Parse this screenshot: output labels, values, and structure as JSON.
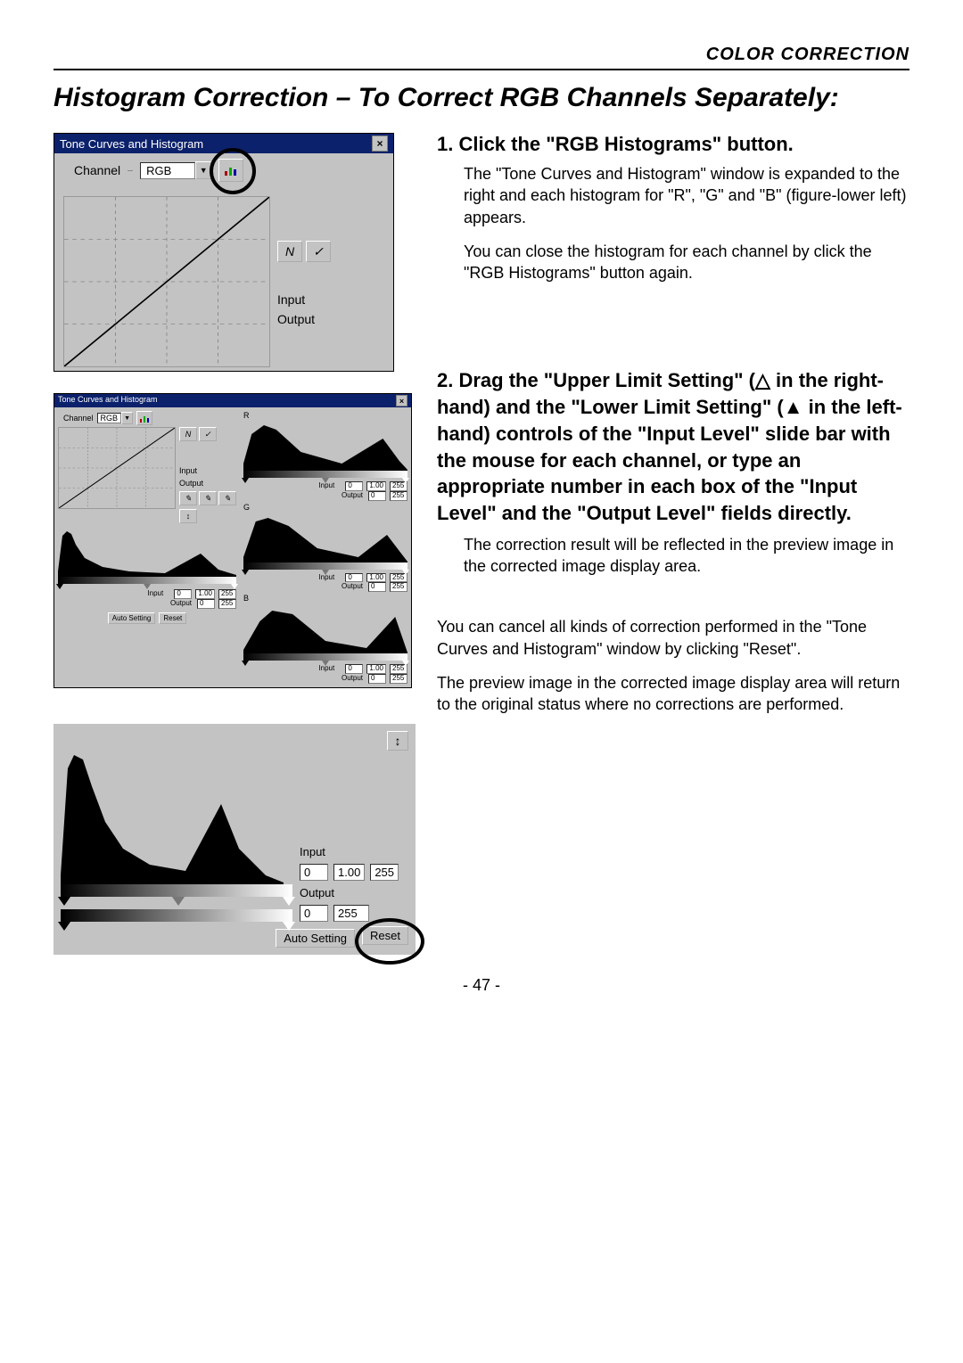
{
  "header": "COLOR CORRECTION",
  "title": "Histogram Correction – To Correct RGB Channels Separately:",
  "step1": {
    "heading": "1. Click the \"RGB Histograms\" button.",
    "p1": "The \"Tone Curves and Histogram\" window is expanded to the right and each histogram for \"R\", \"G\" and \"B\" (figure-lower left) appears.",
    "p2": "You can close the histogram for each channel by click the \"RGB Histograms\" button again."
  },
  "step2": {
    "heading": "2. Drag the \"Upper Limit Setting\" (△ in the right-hand) and the \"Lower Limit Setting\" (▲ in the left-hand) controls of the \"Input Level\" slide bar with the mouse for each channel, or type an appropriate number in each box of the \"Input Level\" and the \"Output Level\" fields directly.",
    "p1": "The correction result will be reflected in the preview image in the corrected image display area."
  },
  "note": {
    "p1": "You can cancel all kinds of correction performed in the \"Tone Curves and Histogram\" window by clicking \"Reset\".",
    "p2": "The preview image in the corrected image display area will return to the original status where no corrections are performed."
  },
  "pagenum": "- 47 -",
  "fig1": {
    "title": "Tone Curves and Histogram",
    "channel_label": "Channel",
    "channel_value": "RGB",
    "input_label": "Input",
    "output_label": "Output"
  },
  "fig3": {
    "input_label": "Input",
    "output_label": "Output",
    "input_values": [
      "0",
      "1.00",
      "255"
    ],
    "output_values": [
      "0",
      "255"
    ],
    "auto_btn": "Auto Setting",
    "reset_btn": "Reset"
  },
  "fig2": {
    "title": "Tone Curves and Histogram",
    "channel_label": "Channel",
    "channel_value": "RGB",
    "labels": {
      "input": "Input",
      "output": "Output",
      "R": "R",
      "G": "G",
      "B": "B"
    },
    "input_values": [
      "0",
      "1.00",
      "255"
    ],
    "output_values": [
      "0",
      "255"
    ],
    "auto_btn": "Auto Setting",
    "reset_btn": "Reset"
  }
}
